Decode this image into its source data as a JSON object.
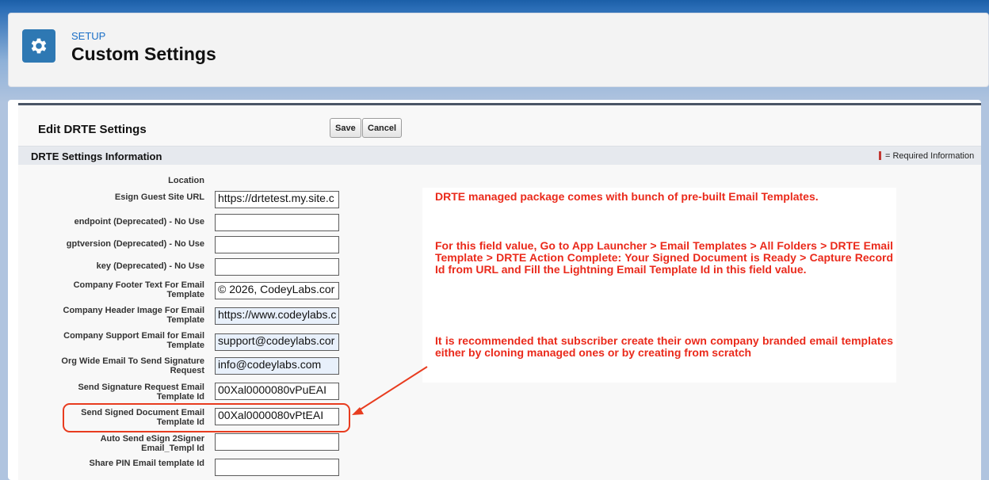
{
  "header": {
    "breadcrumb": "SETUP",
    "title": "Custom Settings",
    "icon": "gear-icon"
  },
  "panel": {
    "title": "Edit DRTE Settings",
    "save_label": "Save",
    "cancel_label": "Cancel",
    "section_title": "DRTE Settings Information",
    "required_legend": "= Required Information",
    "fields": [
      {
        "label": "Location",
        "value": null
      },
      {
        "label": "Esign Guest Site URL",
        "value": "https://drtetest.my.site.c"
      },
      {
        "label": "endpoint (Deprecated) - No Use",
        "value": ""
      },
      {
        "label": "gptversion (Deprecated) - No Use",
        "value": ""
      },
      {
        "label": "key (Deprecated) - No Use",
        "value": ""
      },
      {
        "label": "Company Footer Text For Email Template",
        "value": "© 2026, CodeyLabs.cor"
      },
      {
        "label": "Company Header Image For Email Template",
        "value": "https://www.codeylabs.c"
      },
      {
        "label": "Company Support Email for Email Template",
        "value": "support@codeylabs.cor"
      },
      {
        "label": "Org Wide Email To Send Signature Request",
        "value": "info@codeylabs.com"
      },
      {
        "label": "Send Signature Request Email Template Id",
        "value": "00Xal0000080vPuEAI"
      },
      {
        "label": "Send Signed Document Email Template Id",
        "value": "00Xal0000080vPtEAI"
      },
      {
        "label": "Auto Send eSign 2Signer Email_Templ Id",
        "value": ""
      },
      {
        "label": "Share PIN Email template Id",
        "value": ""
      }
    ]
  },
  "annotation": {
    "paragraphs": [
      "DRTE managed package comes with bunch of pre-built Email Templates.",
      "For this field value, Go to App Launcher > Email Templates > All Folders > DRTE Email Template > DRTE Action Complete: Your Signed Document is Ready > Capture Record Id from URL and Fill the Lightning Email Template Id in this field value.",
      "It is recommended that subscriber create their own company branded email templates either by cloning managed ones or by creating from scratch"
    ],
    "color": "#ea2a1b"
  },
  "colors": {
    "accent": "#2e78b3",
    "link": "#1a6fc7",
    "required": "#c23934",
    "highlight": "#e83c1f"
  }
}
